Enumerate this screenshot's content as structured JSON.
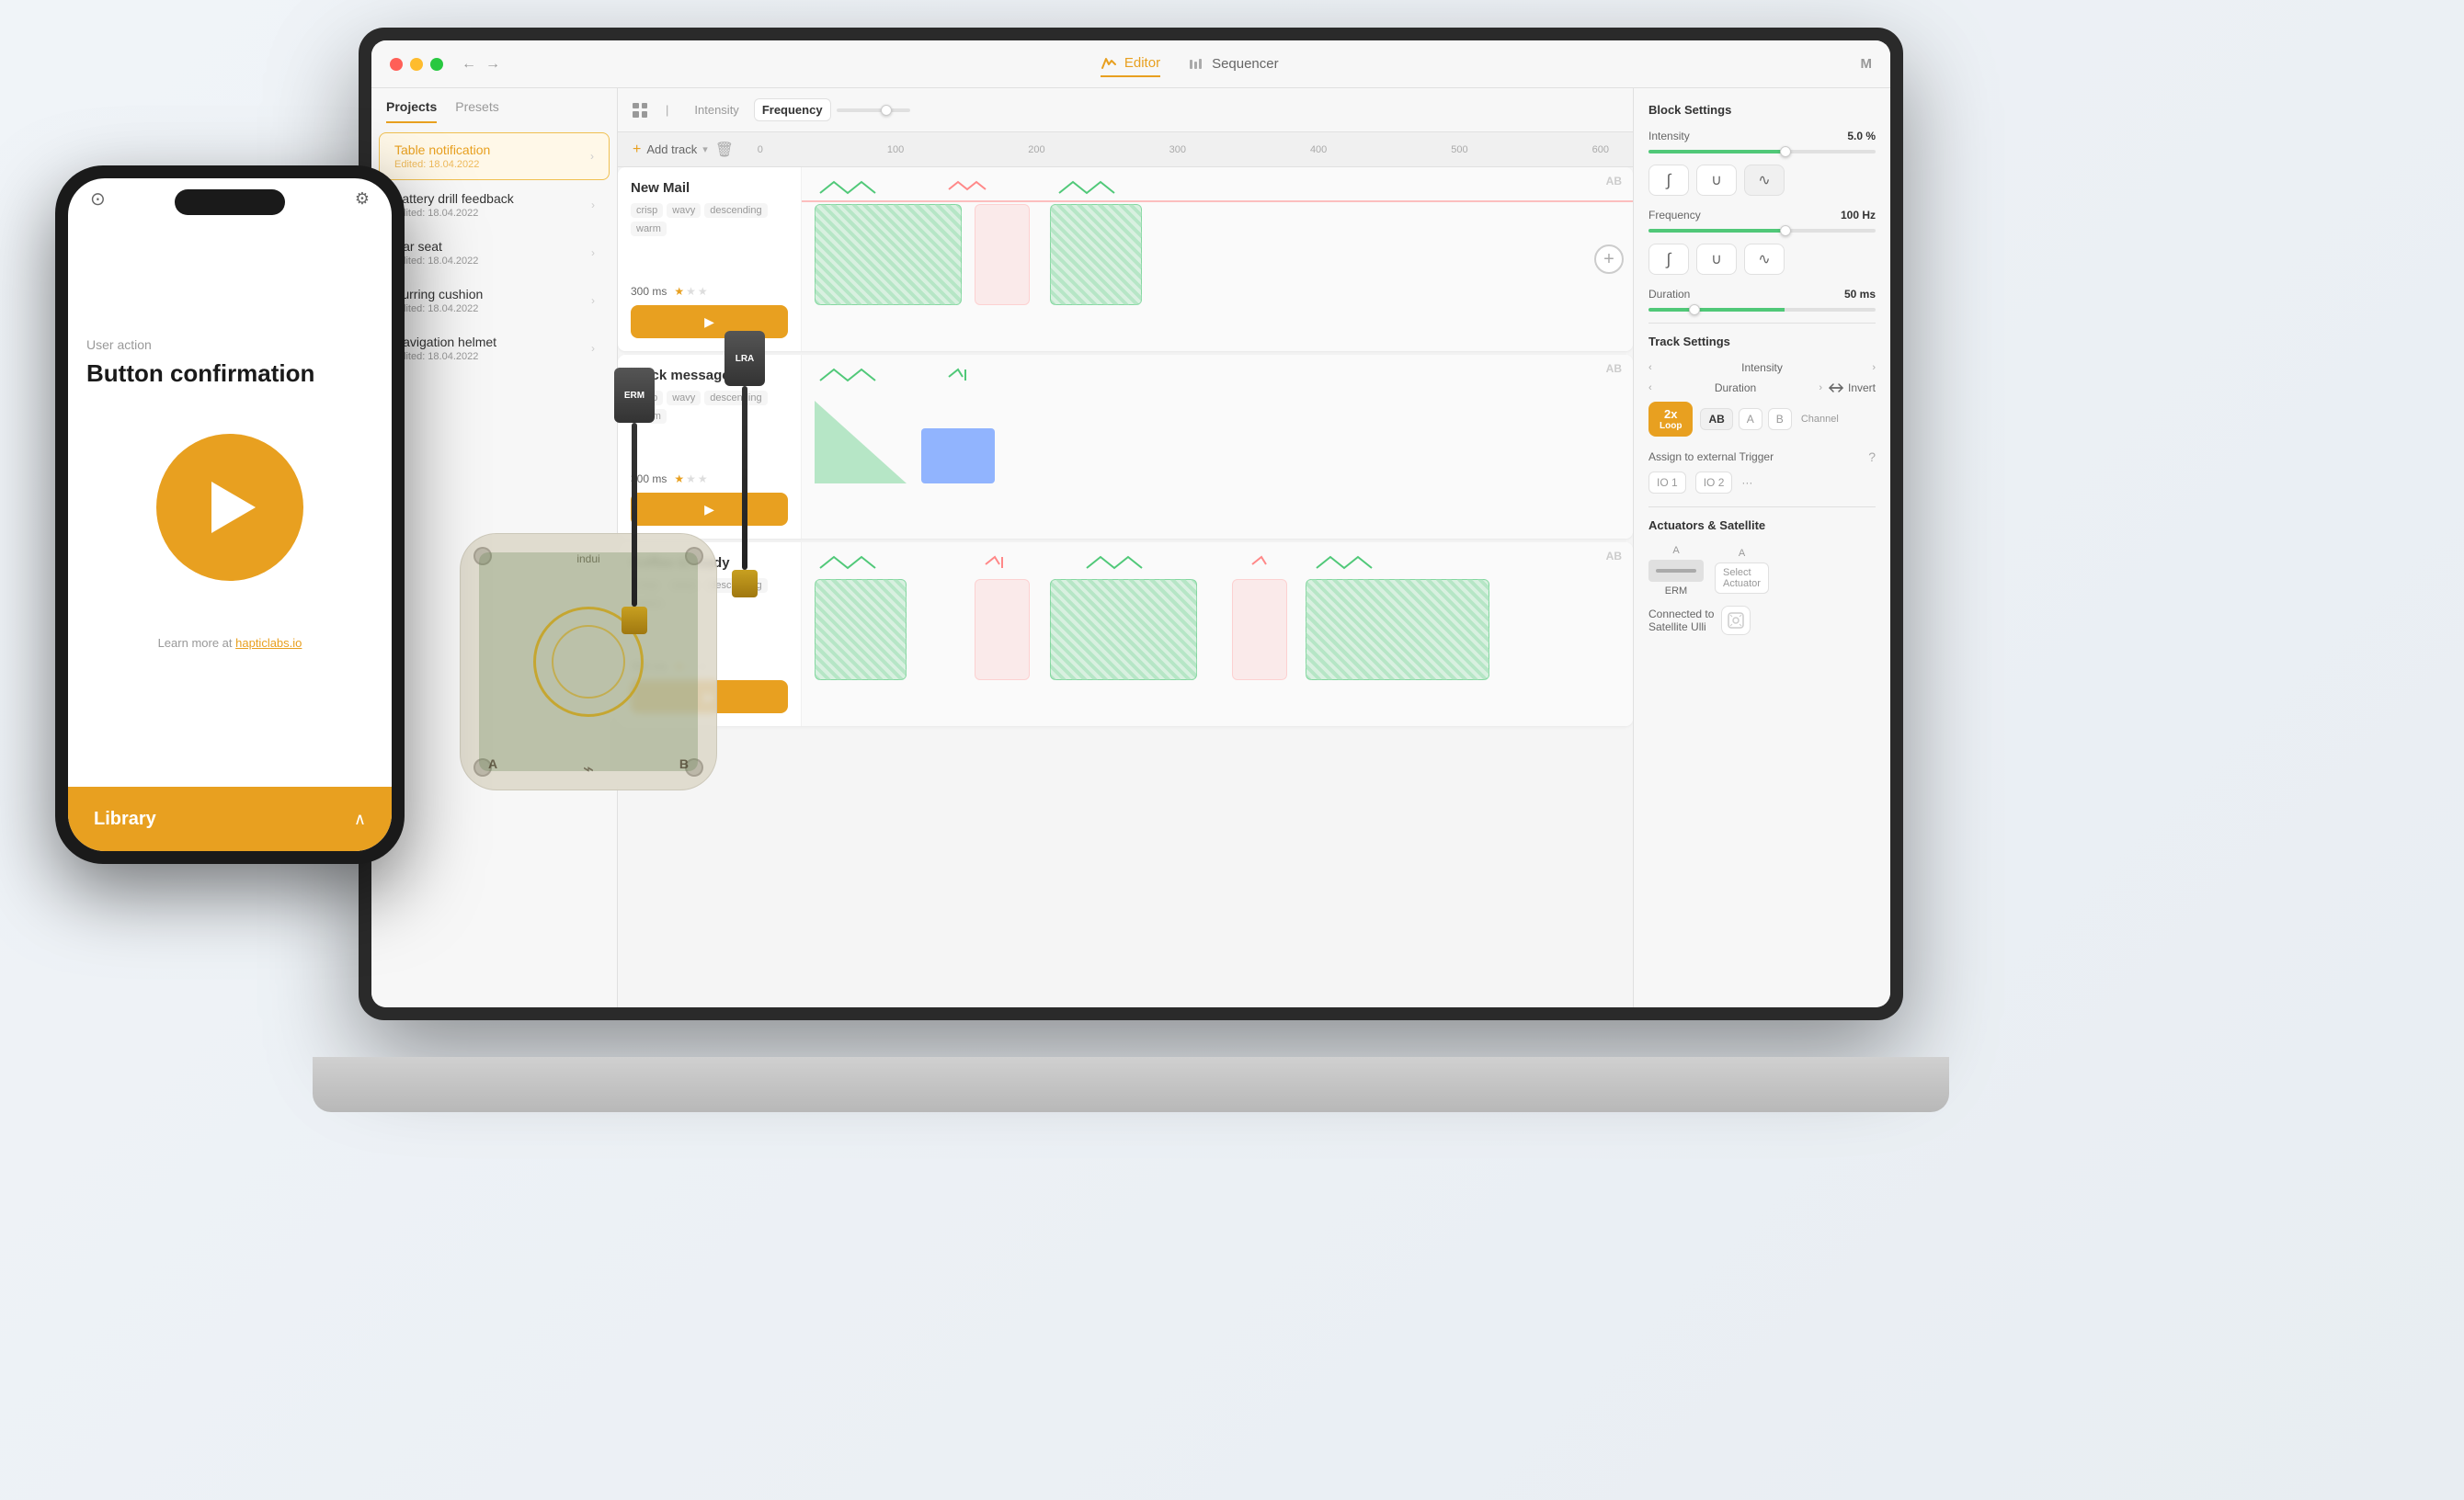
{
  "app": {
    "titlebar": {
      "tabs": [
        {
          "id": "editor",
          "label": "Editor",
          "active": true
        },
        {
          "id": "sequencer",
          "label": "Sequencer",
          "active": false
        }
      ],
      "m_label": "M",
      "title": "Table notification",
      "back_arrow": "←",
      "forward_arrow": "→"
    }
  },
  "sidebar": {
    "tabs": [
      {
        "id": "projects",
        "label": "Projects",
        "active": true
      },
      {
        "id": "presets",
        "label": "Presets",
        "active": false
      }
    ],
    "items": [
      {
        "id": "table-notification",
        "title": "Table notification",
        "subtitle": "Edited: 18.04.2022",
        "active": true
      },
      {
        "id": "battery-drill",
        "title": "Battery drill feedback",
        "subtitle": "Edited: 18.04.2022",
        "active": false
      },
      {
        "id": "car-seat",
        "title": "Car seat",
        "subtitle": "Edited: 18.04.2022",
        "active": false
      },
      {
        "id": "purring-cushion",
        "title": "Purring cushion",
        "subtitle": "Edited: 18.04.2022",
        "active": false
      },
      {
        "id": "navigation-helmet",
        "title": "Navigation helmet",
        "subtitle": "Edited: 18.04.2022",
        "active": false
      }
    ]
  },
  "editor": {
    "toolbar": {
      "add_track": "+ Add track",
      "ruler_marks": [
        "0",
        "100",
        "200",
        "300",
        "400",
        "500",
        "600"
      ]
    },
    "mode_buttons": [
      {
        "label": "Intensity",
        "active": false
      },
      {
        "label": "Frequency",
        "active": true
      }
    ],
    "tracks": [
      {
        "id": "new-mail",
        "name": "New Mail",
        "tags": [
          "crisp",
          "wavy",
          "descending",
          "warm"
        ],
        "duration": "300 ms",
        "stars": [
          1,
          0,
          0
        ],
        "label_ab": "AB"
      },
      {
        "id": "slack-message",
        "name": "Slack message",
        "tags": [
          "crisp",
          "wavy",
          "descending",
          "warm"
        ],
        "duration": "300 ms",
        "stars": [
          1,
          0,
          0
        ],
        "label_ab": "AB"
      },
      {
        "id": "coffee-ready",
        "name": "Coffee is ready",
        "tags": [
          "crisp",
          "wavy",
          "descending",
          "warm"
        ],
        "duration": "300 ms",
        "stars": [
          1,
          0,
          0
        ],
        "label_ab": "AB"
      }
    ]
  },
  "block_settings": {
    "title": "Block Settings",
    "intensity_label": "Intensity",
    "intensity_value": "5.0 %",
    "frequency_label": "Frequency",
    "frequency_value": "100 Hz",
    "duration_label": "Duration",
    "duration_value": "50 ms"
  },
  "track_settings": {
    "title": "Track Settings",
    "intensity_label": "Intensity",
    "duration_label": "Duration",
    "invert_label": "Invert",
    "loop_label": "2x\nLoop",
    "channel_label": "Channel",
    "channels": [
      "AB",
      "A",
      "B"
    ],
    "trigger_label": "Assign to external Trigger",
    "ios": [
      "IO 1",
      "IO 2",
      "..."
    ]
  },
  "actuators": {
    "title": "Actuators & Satellite",
    "items": [
      {
        "label_top": "A",
        "name": "ERM"
      },
      {
        "label_top": "A",
        "name": "Select\nActuator"
      }
    ],
    "satellite_label": "Connected to\nSatellite Ulli"
  },
  "phone": {
    "user_action": "User action",
    "title": "Button confirmation",
    "learn_more": "Learn more at hapticlabs.io",
    "library_label": "Library"
  }
}
